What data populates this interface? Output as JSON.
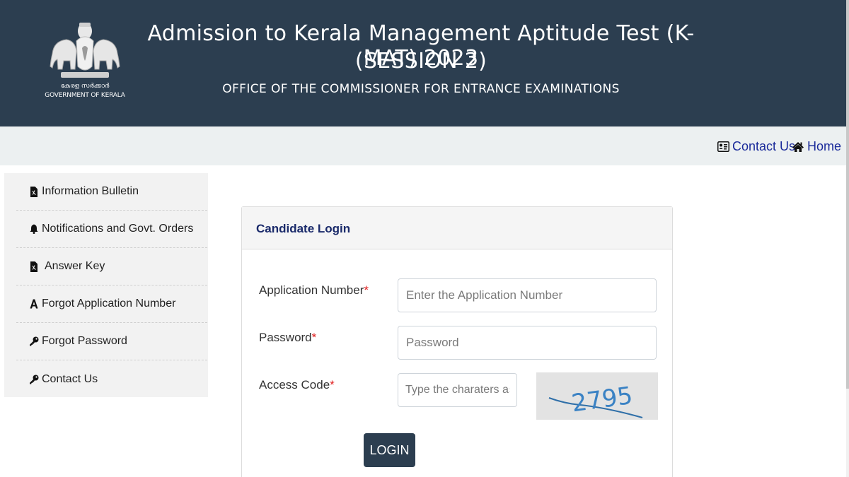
{
  "header": {
    "title_line1": "Admission to Kerala Management Aptitude Test (K-MAT) 2023",
    "title_line2": "(SESSION 2)",
    "subtitle": "OFFICE OF THE COMMISSIONER FOR ENTRANCE EXAMINATIONS",
    "emblem_text_malayalam": "കേരള സർക്കാർ",
    "emblem_text": "GOVERNMENT OF KERALA"
  },
  "nav": {
    "contact_label": "Contact Us",
    "home_label": "Home",
    "link_color": "#1a2a9a"
  },
  "sidebar": {
    "items": [
      {
        "label": "Information Bulletin",
        "icon": "pdf-file-icon"
      },
      {
        "label": "Notifications and Govt. Orders",
        "icon": "bell-icon"
      },
      {
        "label": "Answer Key",
        "icon": "pdf-file-icon"
      },
      {
        "label": "Forgot Application Number",
        "icon": "font-a-icon"
      },
      {
        "label": "Forgot Password",
        "icon": "key-icon"
      },
      {
        "label": "Contact Us",
        "icon": "key-icon"
      }
    ]
  },
  "login": {
    "title": "Candidate Login",
    "application_label": "Application Number",
    "application_placeholder": "Enter the Application Number",
    "password_label": "Password",
    "password_placeholder": "Password",
    "access_label": "Access Code",
    "access_placeholder": "Type the charaters as in",
    "required_mark": "*",
    "captcha_text": "2795",
    "button_label": "LOGIN"
  },
  "colors": {
    "header_bg": "#2c3e50",
    "navbar_bg": "#ecf0f1",
    "sidebar_bg": "#f2f2f2",
    "button_bg": "#2c3e50",
    "required": "#e02020",
    "panel_title": "#1a2a6a"
  }
}
